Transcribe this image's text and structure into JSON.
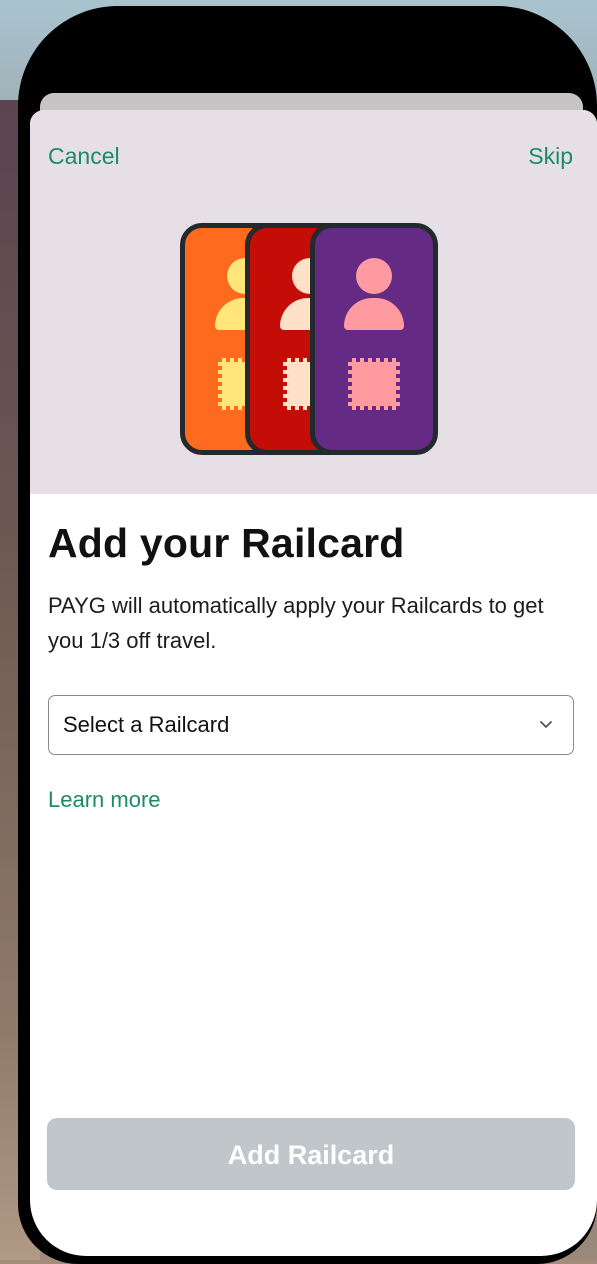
{
  "header": {
    "cancel_label": "Cancel",
    "skip_label": "Skip"
  },
  "illustration": {
    "icon": "railcards-illustration",
    "card_colors": [
      "#ff6a1e",
      "#c40d06",
      "#652a84"
    ],
    "person_colors": [
      "#ffe57a",
      "#ffe1c8",
      "#ff9aa0"
    ]
  },
  "main": {
    "title": "Add your Railcard",
    "description": "PAYG will automatically apply your Railcards to get you 1/3 off travel.",
    "select": {
      "value": "Select a Railcard",
      "icon": "chevron-down-icon"
    },
    "learn_more_label": "Learn more"
  },
  "footer": {
    "add_button_label": "Add Railcard",
    "add_button_state": "disabled"
  },
  "colors": {
    "accent": "#1d8a6b",
    "hero_bg": "#e6e0e6",
    "button_disabled": "#c0c6c9"
  }
}
